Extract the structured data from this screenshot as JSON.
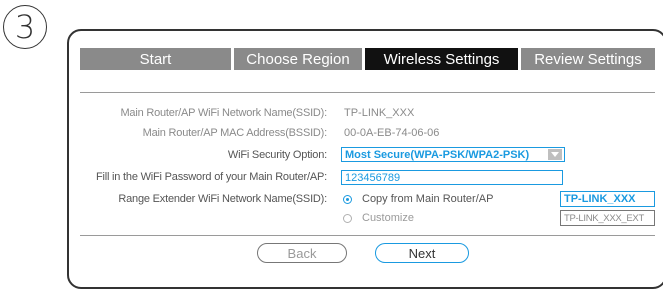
{
  "step": {
    "number": "3"
  },
  "tabs": [
    {
      "label": "Start",
      "active": false
    },
    {
      "label": "Choose Region",
      "active": false
    },
    {
      "label": "Wireless Settings",
      "active": true
    },
    {
      "label": "Review Settings",
      "active": false
    }
  ],
  "fields": {
    "main_ssid": {
      "label": "Main Router/AP WiFi Network Name(SSID):",
      "value": "TP-LINK_XXX"
    },
    "main_mac": {
      "label": "Main Router/AP MAC Address(BSSID):",
      "value": "00-0A-EB-74-06-06"
    },
    "security": {
      "label": "WiFi Security Option:",
      "value": "Most Secure(WPA-PSK/WPA2-PSK)"
    },
    "password": {
      "label": "Fill in the WiFi Password of your Main Router/AP:",
      "value": "123456789"
    },
    "extender_ssid": {
      "label": "Range Extender WiFi Network Name(SSID):",
      "options": [
        {
          "label": "Copy from Main Router/AP",
          "selected": true,
          "value": "TP-LINK_XXX"
        },
        {
          "label": "Customize",
          "selected": false,
          "value": "TP-LINK_XXX_EXT"
        }
      ]
    }
  },
  "buttons": {
    "back": "Back",
    "next": "Next"
  },
  "colors": {
    "accent": "#1a9ae0",
    "tab_inactive": "#8a8a8a",
    "tab_active": "#111111"
  }
}
